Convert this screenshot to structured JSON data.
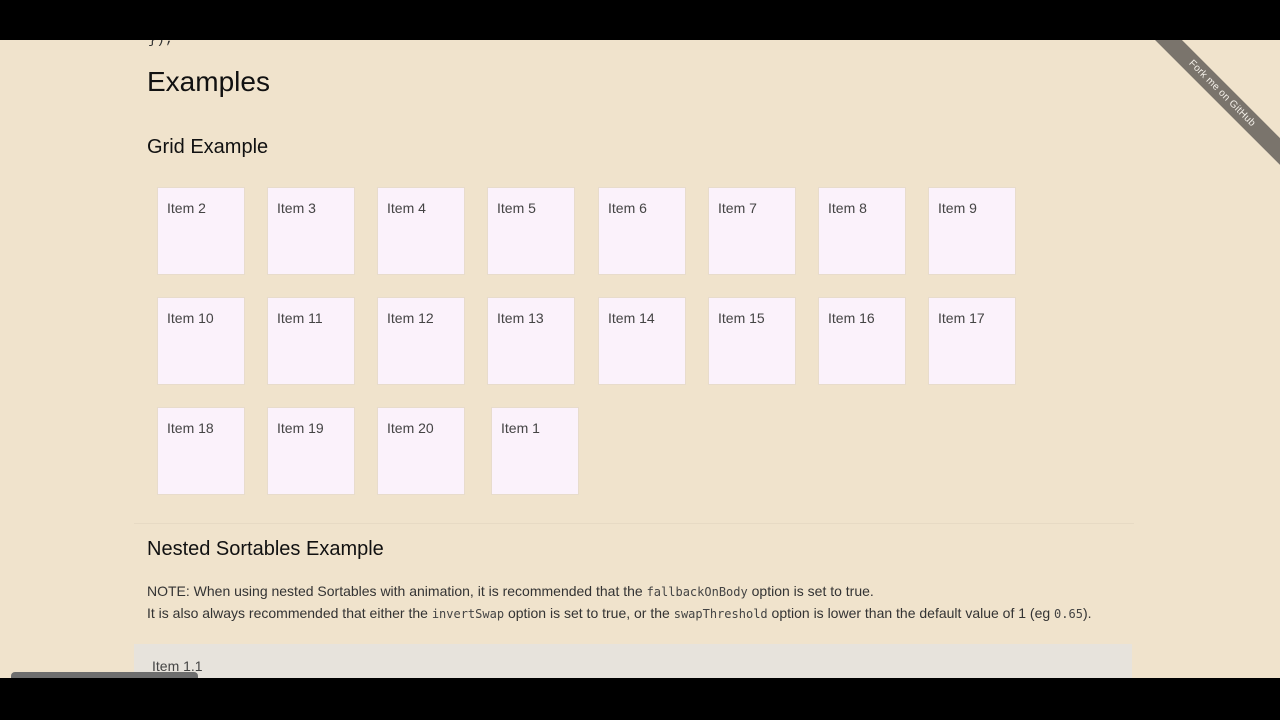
{
  "page": {
    "top_fragment": "});",
    "title": "Examples",
    "ribbon": "Fork me on GitHub"
  },
  "grid_example": {
    "heading": "Grid Example",
    "items": [
      "Item 2",
      "Item 3",
      "Item 4",
      "Item 5",
      "Item 6",
      "Item 7",
      "Item 8",
      "Item 9",
      "Item 10",
      "Item 11",
      "Item 12",
      "Item 13",
      "Item 14",
      "Item 15",
      "Item 16",
      "Item 17",
      "Item 18",
      "Item 19",
      "Item 20",
      "Item 1"
    ]
  },
  "nested_example": {
    "heading": "Nested Sortables Example",
    "note_line1_prefix": "NOTE: When using nested Sortables with animation, it is recommended that the ",
    "note_line1_code": "fallbackOnBody",
    "note_line1_suffix": " option is set to true.",
    "note_line2_prefix": "It is also always recommended that either the ",
    "note_line2_code1": "invertSwap",
    "note_line2_mid": " option is set to true, or the ",
    "note_line2_code2": "swapThreshold",
    "note_line2_mid2": " option is lower than the default value of 1 (eg ",
    "note_line2_code3": "0.65",
    "note_line2_suffix": ").",
    "first_item": "Item 1.1"
  },
  "toolbar": {
    "icons": [
      "pointer-icon",
      "pencil-icon",
      "broom-icon",
      "pause-icon",
      "chevron-left-icon"
    ],
    "collapse_glyph": "‹"
  }
}
